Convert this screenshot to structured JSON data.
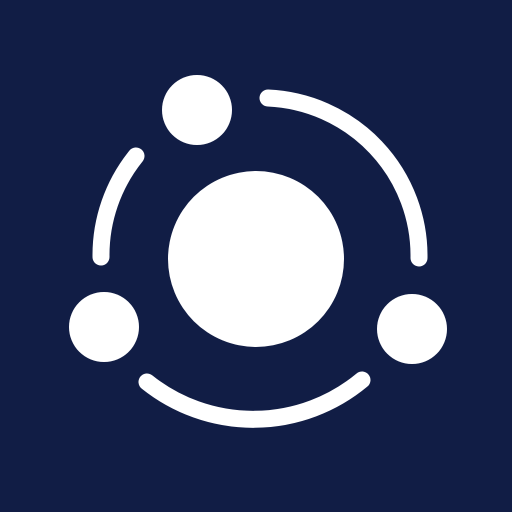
{
  "icon": {
    "name": "orbit-network-icon",
    "background_color": "#111D45",
    "foreground_color": "#FFFFFF"
  }
}
